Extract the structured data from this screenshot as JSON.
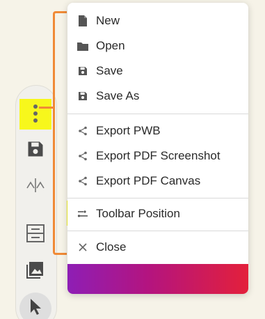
{
  "menu": {
    "file_items": [
      {
        "label": "New",
        "icon": "document-icon"
      },
      {
        "label": "Open",
        "icon": "folder-icon"
      },
      {
        "label": "Save",
        "icon": "save-icon"
      },
      {
        "label": "Save As",
        "icon": "save-icon"
      }
    ],
    "export_items": [
      {
        "label": "Export PWB",
        "icon": "share-icon"
      },
      {
        "label": "Export PDF Screenshot",
        "icon": "share-icon"
      },
      {
        "label": "Export PDF Canvas",
        "icon": "share-icon"
      }
    ],
    "toolbar_position": {
      "label": "Toolbar Position",
      "icon": "toolbar-position-icon"
    },
    "close": {
      "label": "Close",
      "icon": "close-icon"
    }
  },
  "toolbar": {
    "items": [
      "more-vertical-icon",
      "save-icon",
      "split-icon",
      "grid-icon",
      "image-icon",
      "cursor-icon"
    ]
  },
  "colors": {
    "highlight": "#f5f425",
    "bracket": "#f08a36",
    "gradient_start": "#8e1eb5",
    "gradient_end": "#e3203b",
    "icon": "#555555"
  }
}
